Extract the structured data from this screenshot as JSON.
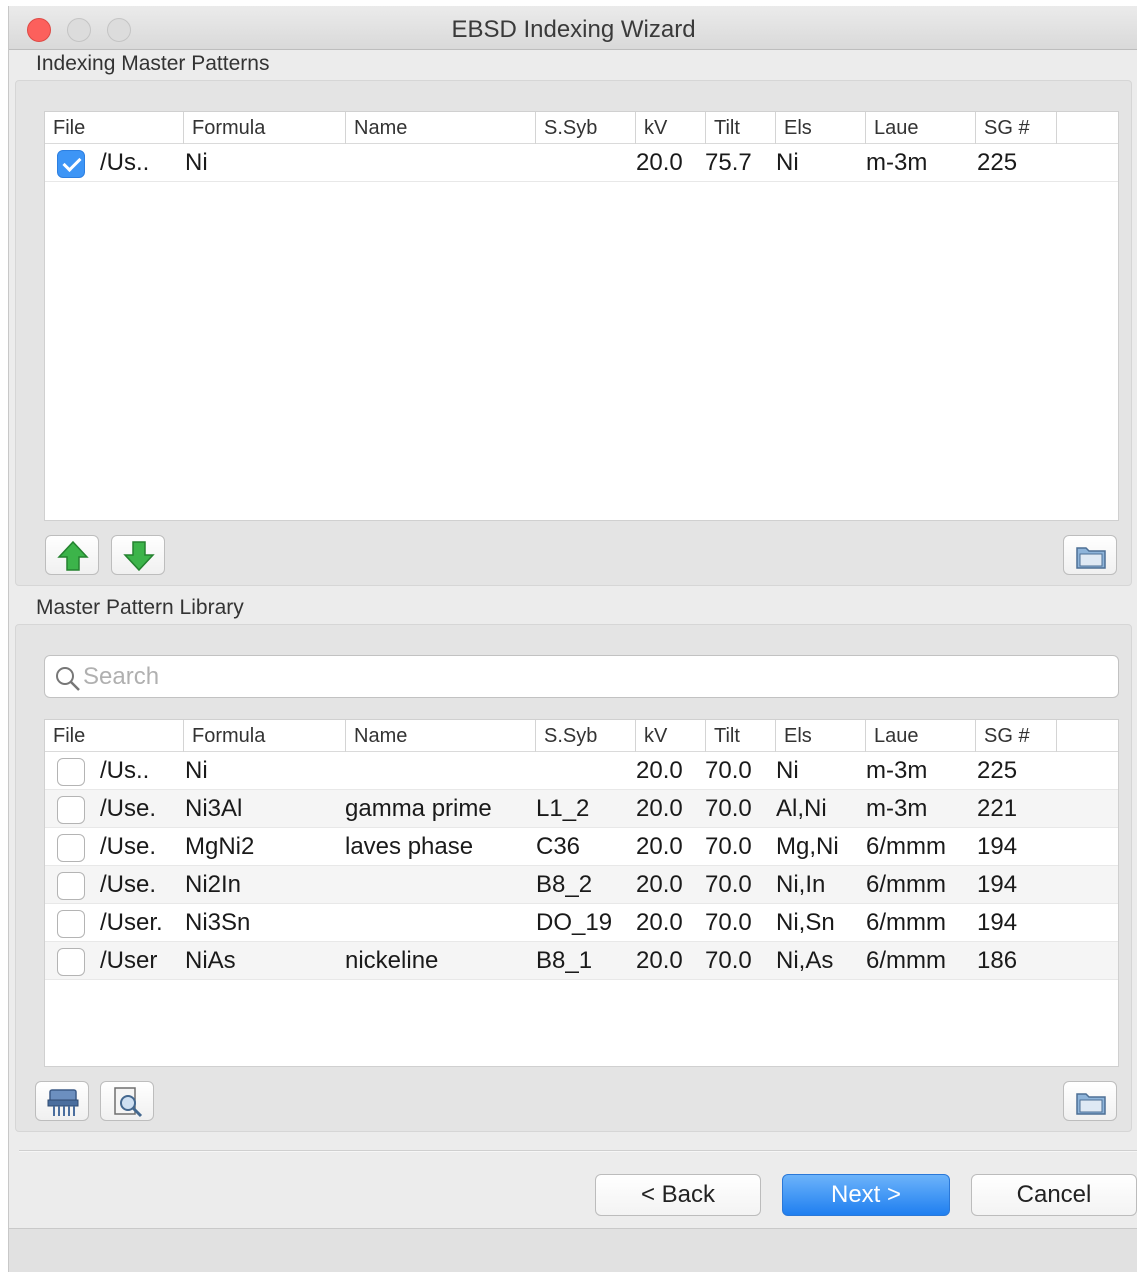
{
  "window": {
    "title": "EBSD Indexing Wizard"
  },
  "indexing_group": {
    "label": "Indexing Master Patterns",
    "columns": [
      "File",
      "Formula",
      "Name",
      "S.Syb",
      "kV",
      "Tilt",
      "Els",
      "Laue",
      "SG #"
    ],
    "rows": [
      {
        "checked": true,
        "file": "/Us..",
        "formula": "Ni",
        "name": "",
        "ssyb": "",
        "kv": "20.0",
        "tilt": "75.7",
        "els": "Ni",
        "laue": "m-3m",
        "sg": "225"
      }
    ],
    "buttons": {
      "up": "move-up-icon",
      "down": "move-down-icon",
      "folder": "folder-icon"
    }
  },
  "library_group": {
    "label": "Master Pattern Library",
    "search_placeholder": "Search",
    "columns": [
      "File",
      "Formula",
      "Name",
      "S.Syb",
      "kV",
      "Tilt",
      "Els",
      "Laue",
      "SG #"
    ],
    "rows": [
      {
        "checked": false,
        "file": "/Us..",
        "formula": "Ni",
        "name": "",
        "ssyb": "",
        "kv": "20.0",
        "tilt": "70.0",
        "els": "Ni",
        "laue": "m-3m",
        "sg": "225"
      },
      {
        "checked": false,
        "file": "/Use.",
        "formula": "Ni3Al",
        "name": "gamma prime",
        "ssyb": "L1_2",
        "kv": "20.0",
        "tilt": "70.0",
        "els": "Al,Ni",
        "laue": "m-3m",
        "sg": "221"
      },
      {
        "checked": false,
        "file": "/Use.",
        "formula": "MgNi2",
        "name": "laves phase",
        "ssyb": "C36",
        "kv": "20.0",
        "tilt": "70.0",
        "els": "Mg,Ni",
        "laue": "6/mmm",
        "sg": "194"
      },
      {
        "checked": false,
        "file": "/Use.",
        "formula": "Ni2In",
        "name": "",
        "ssyb": "B8_2",
        "kv": "20.0",
        "tilt": "70.0",
        "els": "Ni,In",
        "laue": "6/mmm",
        "sg": "194"
      },
      {
        "checked": false,
        "file": "/User.",
        "formula": "Ni3Sn",
        "name": "",
        "ssyb": "DO_19",
        "kv": "20.0",
        "tilt": "70.0",
        "els": "Ni,Sn",
        "laue": "6/mmm",
        "sg": "194"
      },
      {
        "checked": false,
        "file": "/User",
        "formula": "NiAs",
        "name": "nickeline",
        "ssyb": "B8_1",
        "kv": "20.0",
        "tilt": "70.0",
        "els": "Ni,As",
        "laue": "6/mmm",
        "sg": "186"
      }
    ],
    "buttons": {
      "shred": "shredder-icon",
      "inspect": "magnifier-document-icon",
      "folder": "folder-icon"
    }
  },
  "footer": {
    "back_label": "< Back",
    "next_label": "Next >",
    "cancel_label": "Cancel"
  },
  "colors": {
    "accent": "#1f7ff0",
    "close": "#fc605c",
    "arrow": "#3cb44a"
  }
}
